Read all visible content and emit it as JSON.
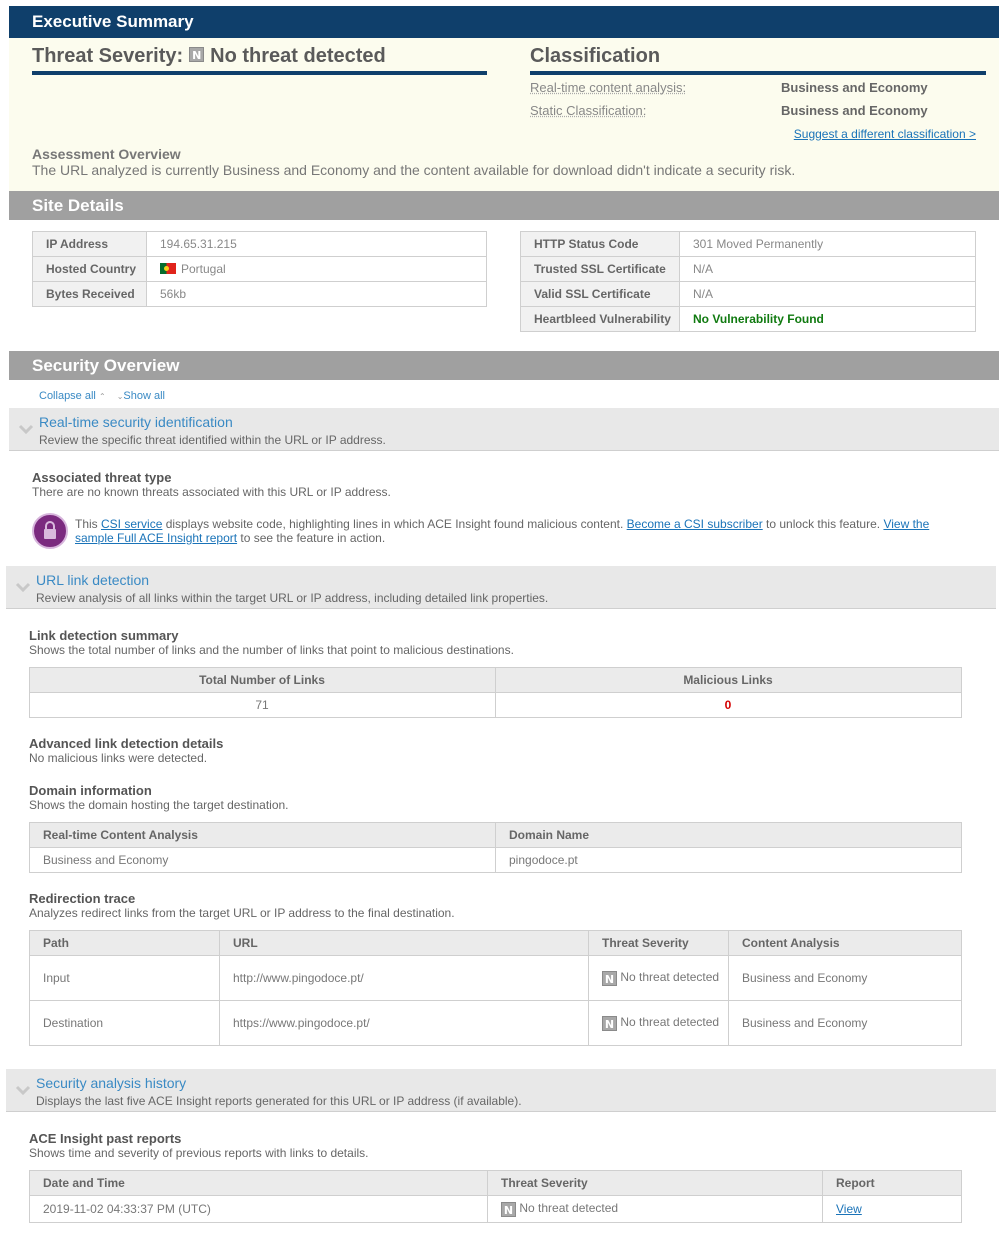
{
  "executive": {
    "title": "Executive Summary",
    "threat_label": "Threat Severity:",
    "threat_icon": "N",
    "threat_value": "No threat detected",
    "classification_title": "Classification",
    "rows": [
      {
        "label": "Real-time content analysis:",
        "value": "Business and Economy"
      },
      {
        "label": "Static Classification:",
        "value": "Business and Economy"
      }
    ],
    "suggest": "Suggest a different classification >",
    "assessment_heading": "Assessment Overview",
    "assessment_text": "The URL analyzed is currently Business and Economy and the content available for download didn't indicate a security risk."
  },
  "site": {
    "title": "Site Details",
    "left": [
      {
        "label": "IP Address",
        "value": "194.65.31.215"
      },
      {
        "label": "Hosted Country",
        "value": "Portugal"
      },
      {
        "label": "Bytes Received",
        "value": "56kb"
      }
    ],
    "right": [
      {
        "label": "HTTP Status Code",
        "value": "301 Moved Permanently"
      },
      {
        "label": "Trusted SSL Certificate",
        "value": "N/A"
      },
      {
        "label": "Valid SSL Certificate",
        "value": "N/A"
      },
      {
        "label": "Heartbleed Vulnerability",
        "value": "No Vulnerability Found"
      }
    ]
  },
  "security": {
    "title": "Security Overview",
    "collapse_all": "Collapse all",
    "show_all": "Show all",
    "realtime": {
      "title": "Real-time security identification",
      "desc": "Review the specific threat identified within the URL or IP address.",
      "assoc_heading": "Associated threat type",
      "assoc_text": "There are no known threats associated with this URL or IP address.",
      "csi_pre": "This ",
      "csi_link": "CSI service",
      "csi_mid": " displays website code, highlighting lines in which ACE Insight found malicious content. ",
      "csi_link2": "Become a CSI subscriber",
      "csi_mid2": " to unlock this feature. ",
      "csi_link3": "View the sample Full ACE Insight report",
      "csi_post": " to see the feature in action."
    },
    "links": {
      "title": "URL link detection",
      "desc": "Review analysis of all links within the target URL or IP address, including detailed link properties.",
      "summary_heading": "Link detection summary",
      "summary_text": "Shows the total number of links and the number of links that point to malicious destinations.",
      "total_header": "Total Number of Links",
      "malicious_header": "Malicious Links",
      "total_value": "71",
      "malicious_value": "0",
      "advanced_heading": "Advanced link detection details",
      "advanced_text": "No malicious links were detected.",
      "domain_heading": "Domain information",
      "domain_text": "Shows the domain hosting the target destination.",
      "domain_headers": [
        "Real-time Content Analysis",
        "Domain Name"
      ],
      "domain_row": [
        "Business and Economy",
        "pingodoce.pt"
      ],
      "redirect_heading": "Redirection trace",
      "redirect_text": "Analyzes redirect links from the target URL or IP address to the final destination.",
      "redirect_headers": [
        "Path",
        "URL",
        "Threat Severity",
        "Content Analysis"
      ],
      "redirect_rows": [
        {
          "path": "Input",
          "url": "http://www.pingodoce.pt/",
          "threat": "No threat detected",
          "content": "Business and Economy"
        },
        {
          "path": "Destination",
          "url": "https://www.pingodoce.pt/",
          "threat": "No threat detected",
          "content": "Business and Economy"
        }
      ]
    },
    "history": {
      "title": "Security analysis history",
      "desc": "Displays the last five ACE Insight reports generated for this URL or IP address (if available).",
      "past_heading": "ACE Insight past reports",
      "past_text": "Shows time and severity of previous reports with links to details.",
      "headers": [
        "Date and Time",
        "Threat Severity",
        "Report"
      ],
      "rows": [
        {
          "date": "2019-11-02 04:33:37 PM (UTC)",
          "threat": "No threat detected",
          "report": "View"
        }
      ]
    }
  }
}
